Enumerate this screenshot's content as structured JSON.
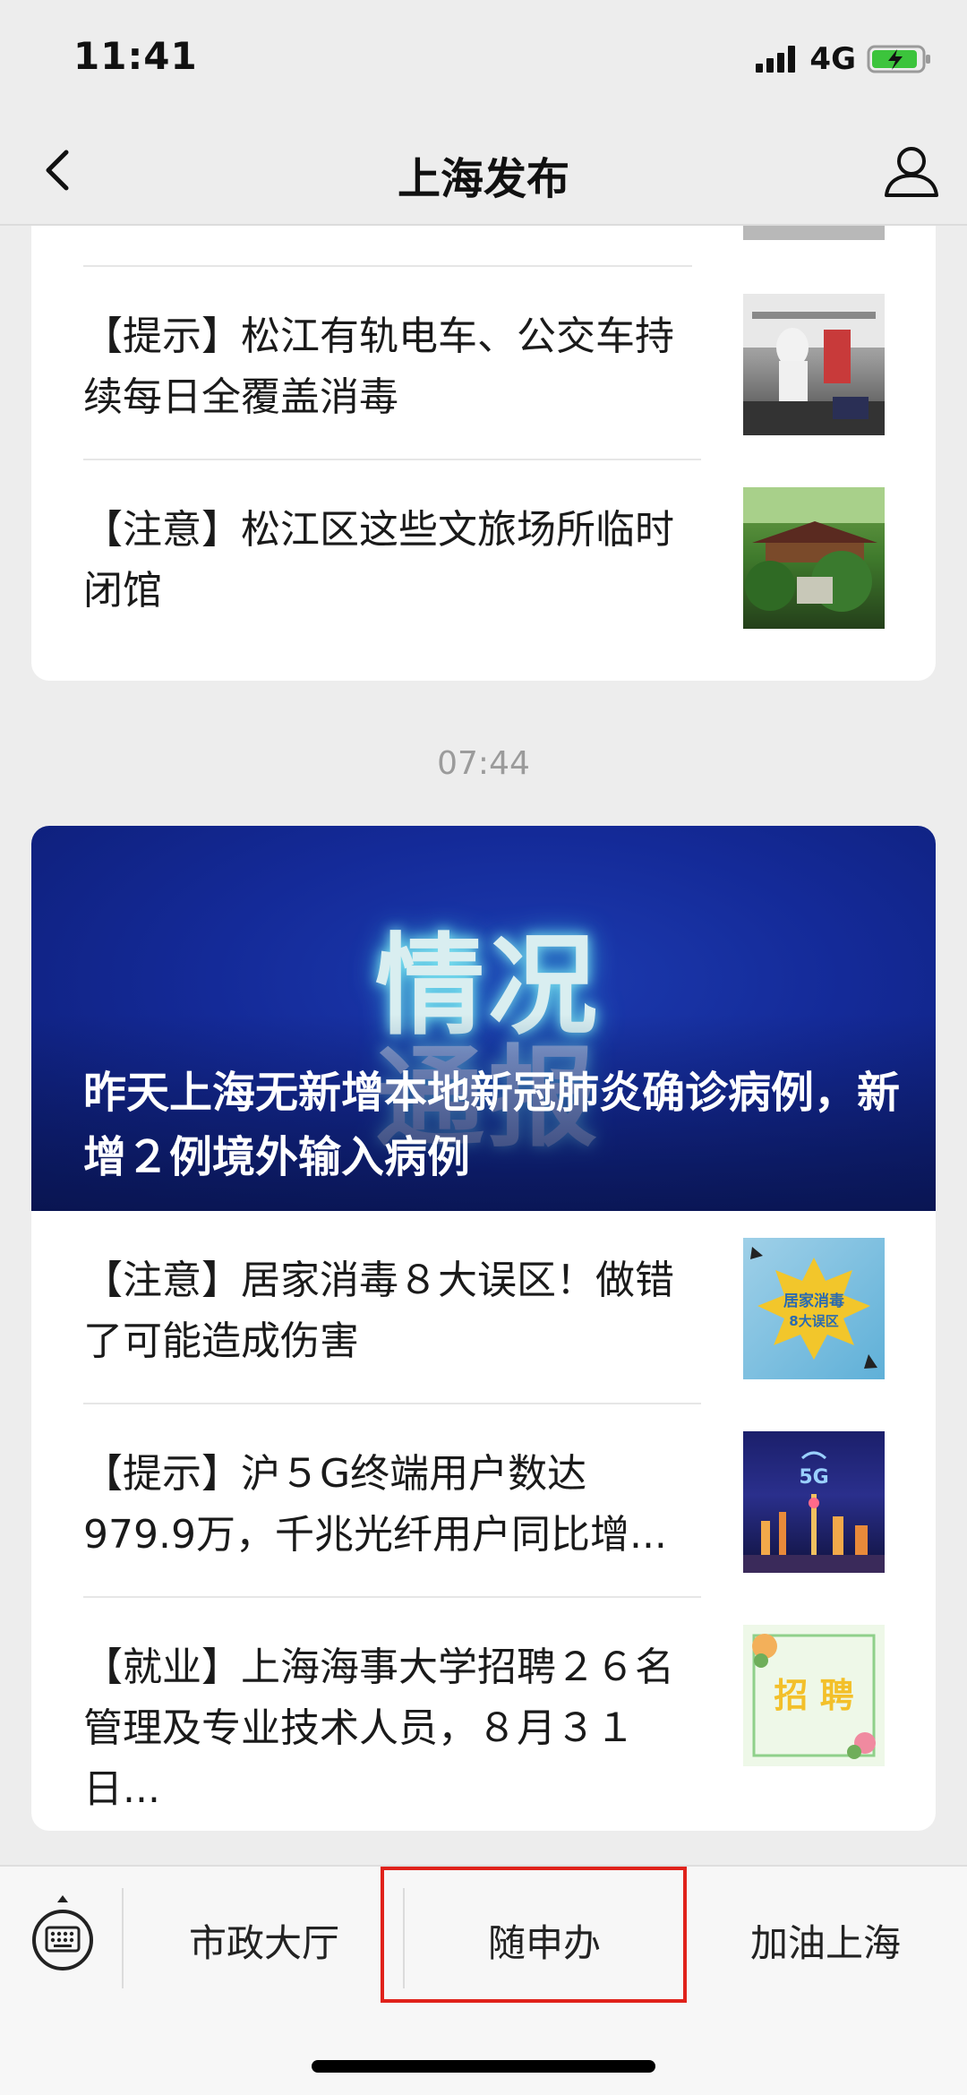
{
  "status_bar": {
    "time": "11:41",
    "network": "4G"
  },
  "nav": {
    "title": "上海发布",
    "back_icon": "chevron-left-icon",
    "profile_icon": "user-icon"
  },
  "articles_top": [
    {
      "text": "【提示】松江有轨电车、公交车持续每日全覆盖消毒",
      "thumb": "tram-photo"
    },
    {
      "text": "【注意】松江区这些文旅场所临时闭馆",
      "thumb": "garden-photo"
    }
  ],
  "timestamp": "07:44",
  "featured": {
    "banner_art_text": [
      "情况",
      "通报"
    ],
    "title": "昨天上海无新增本地新冠肺炎确诊病例，新增２例境外输入病例"
  },
  "articles_bottom": [
    {
      "text": "【注意】居家消毒８大误区！做错了可能造成伤害",
      "thumb": "disinfect-graphic",
      "thumb_text": "居家消毒\n8大误区"
    },
    {
      "text": "【提示】沪５G终端用户数达979.9万，千兆光纤用户同比增...",
      "thumb": "5g-cityscape",
      "thumb_text": "5G"
    },
    {
      "text": "【就业】上海海事大学招聘２６名管理及专业技术人员，８月３１日...",
      "thumb": "recruit-graphic",
      "thumb_text": "招 聘"
    }
  ],
  "bottom_menu": {
    "keyboard_icon": "keyboard-icon",
    "items": [
      "市政大厅",
      "随申办",
      "加油上海"
    ]
  },
  "colors": {
    "background": "#ededed",
    "highlight": "#e0221b",
    "banner": "#142a98"
  }
}
